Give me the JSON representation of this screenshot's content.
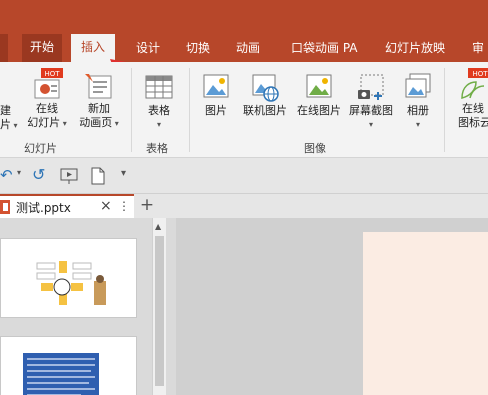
{
  "tabs": [
    "开始",
    "插入",
    "设计",
    "切换",
    "动画",
    "口袋动画 PA",
    "幻灯片放映",
    "审"
  ],
  "ribbon": {
    "slides": {
      "new_slide_label": "建",
      "new_slide_sub": "片",
      "online_slides_label": "在线",
      "online_slides_sub": "幻灯片",
      "new_anim_page_label": "新加",
      "new_anim_page_sub": "动画页",
      "group_label": "幻灯片",
      "hot_badge": "HOT"
    },
    "table": {
      "table_label": "表格",
      "group_label": "表格"
    },
    "images": {
      "picture_label": "图片",
      "online_picture_label": "联机图片",
      "online_image_label": "在线图片",
      "screenshot_label": "屏幕截图",
      "album_label": "相册",
      "group_label": "图像"
    },
    "online_icons": {
      "label": "在线",
      "sub": "图标云",
      "hot_badge": "HOT"
    }
  },
  "doc_tab": {
    "filename": "测试.pptx",
    "close": "×",
    "more": "⋮",
    "add": "+"
  },
  "colors": {
    "accent": "#b7472a",
    "accent_dark": "#9a3820",
    "ribbon_bg": "#f3f3f3"
  }
}
